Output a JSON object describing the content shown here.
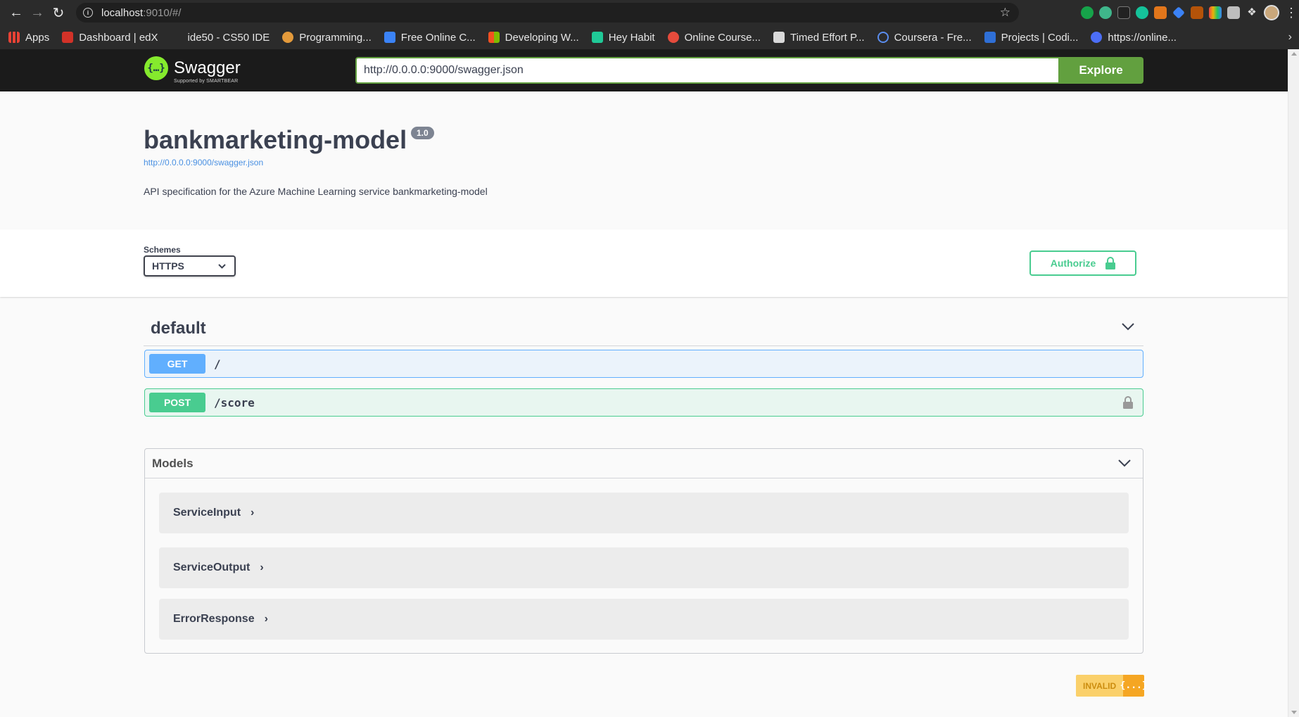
{
  "browser": {
    "url_host": "localhost",
    "url_rest": ":9010/#/",
    "bookmarks": [
      {
        "label": "Apps",
        "icon": "apps-grid-icon",
        "color": "#e94235"
      },
      {
        "label": "Dashboard | edX",
        "icon": "edx-icon",
        "color": "#d23228"
      },
      {
        "label": "ide50 - CS50 IDE",
        "icon": "blank-icon",
        "color": "#2b2b2b"
      },
      {
        "label": "Programming...",
        "icon": "cookie-icon",
        "color": "#e39a3b"
      },
      {
        "label": "Free Online C...",
        "icon": "udemy-icon",
        "color": "#3b83f6"
      },
      {
        "label": "Developing W...",
        "icon": "microsoft-icon",
        "color": "#f25022"
      },
      {
        "label": "Hey Habit",
        "icon": "habit-icon",
        "color": "#20c997"
      },
      {
        "label": "Online Course...",
        "icon": "udacity-icon",
        "color": "#e54b3c"
      },
      {
        "label": "Timed Effort P...",
        "icon": "trello-icon",
        "color": "#d9d9d9"
      },
      {
        "label": "Coursera - Fre...",
        "icon": "coursera-icon",
        "color": "#5a8dee"
      },
      {
        "label": "Projects | Codi...",
        "icon": "codio-icon",
        "color": "#2f6fd6"
      },
      {
        "label": "https://online...",
        "icon": "s-icon",
        "color": "#4c6ef5"
      }
    ]
  },
  "topbar": {
    "logo_text": "Swagger",
    "logo_sub": "Supported by SMARTBEAR",
    "spec_url": "http://0.0.0.0:9000/swagger.json",
    "explore_label": "Explore"
  },
  "info": {
    "title": "bankmarketing-model",
    "version": "1.0",
    "link": "http://0.0.0.0:9000/swagger.json",
    "description": "API specification for the Azure Machine Learning service bankmarketing-model"
  },
  "schemes": {
    "label": "Schemes",
    "selected": "HTTPS",
    "authorize_label": "Authorize"
  },
  "tag": {
    "name": "default"
  },
  "operations": [
    {
      "method": "GET",
      "path": "/"
    },
    {
      "method": "POST",
      "path": "/score"
    }
  ],
  "models": {
    "title": "Models",
    "items": [
      "ServiceInput",
      "ServiceOutput",
      "ErrorResponse"
    ]
  },
  "validator": {
    "label": "INVALID",
    "icon_text": "{...}"
  },
  "colors": {
    "get": "#61affe",
    "post": "#49cc90",
    "explore": "#62a03f",
    "invalid_bg": "#fad06a"
  }
}
